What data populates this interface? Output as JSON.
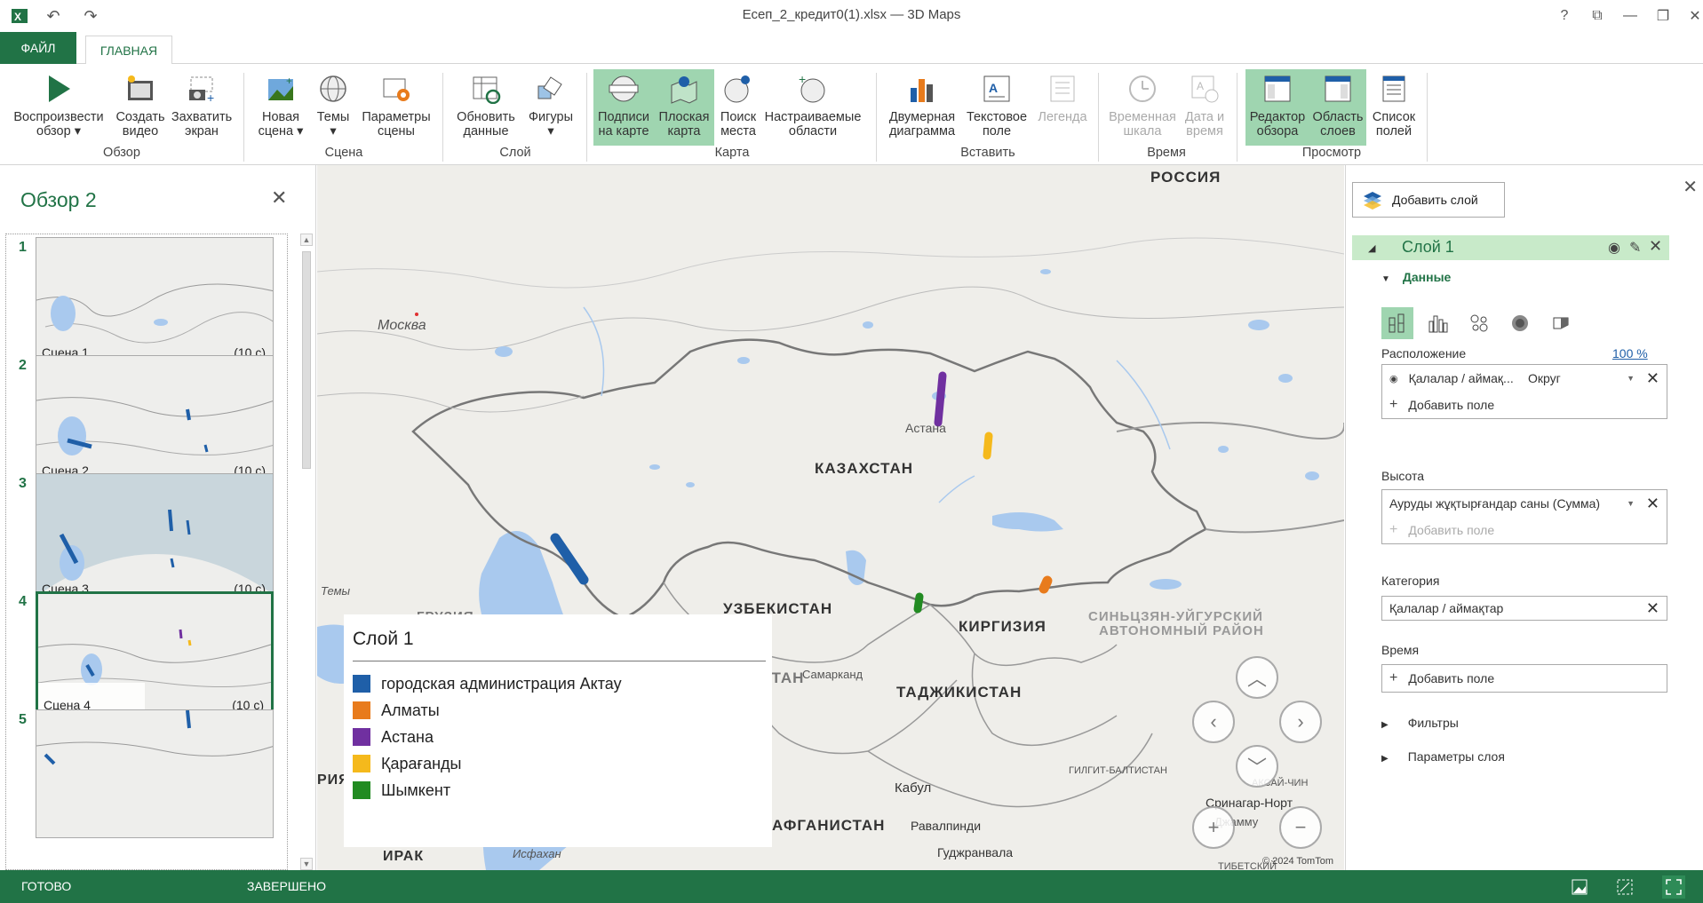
{
  "window": {
    "title": "Есеп_2_кредит0(1).xlsx — 3D Maps"
  },
  "tabs": {
    "file": "ФАЙЛ",
    "home": "ГЛАВНАЯ"
  },
  "ribbon": {
    "tour": {
      "play": [
        "Воспроизвести",
        "обзор ▾"
      ],
      "create_video": [
        "Создать",
        "видео"
      ],
      "capture": [
        "Захватить",
        "экран"
      ],
      "group": "Обзор"
    },
    "scene": {
      "new": [
        "Новая",
        "сцена ▾"
      ],
      "themes": [
        "Темы",
        "▾"
      ],
      "options": [
        "Параметры",
        "сцены"
      ],
      "group": "Сцена"
    },
    "layer": {
      "refresh": [
        "Обновить",
        "данные"
      ],
      "shapes": [
        "Фигуры",
        "▾"
      ],
      "group": "Слой"
    },
    "map": {
      "labels": [
        "Подписи",
        "на карте"
      ],
      "flat": [
        "Плоская",
        "карта"
      ],
      "find": [
        "Поиск",
        "места"
      ],
      "regions": [
        "Настраиваемые",
        "области"
      ],
      "group": "Карта"
    },
    "insert": {
      "chart2d": [
        "Двумерная",
        "диаграмма"
      ],
      "textbox": [
        "Текстовое",
        "поле"
      ],
      "legend": [
        "Легенда",
        ""
      ],
      "group": "Вставить"
    },
    "time": {
      "timeline": [
        "Временная",
        "шкала"
      ],
      "datetime": [
        "Дата и",
        "время"
      ],
      "group": "Время"
    },
    "view": {
      "tour_editor": [
        "Редактор",
        "обзора"
      ],
      "layer_pane": [
        "Область",
        "слоев"
      ],
      "field_list": [
        "Список",
        "полей"
      ],
      "group": "Просмотр"
    }
  },
  "tour_panel": {
    "title": "Обзор 2",
    "scenes": [
      {
        "num": "1",
        "name": "Сцена 1",
        "duration": "(10 с)"
      },
      {
        "num": "2",
        "name": "Сцена 2",
        "duration": "(10 с)"
      },
      {
        "num": "3",
        "name": "Сцена 3",
        "duration": "(10 с)"
      },
      {
        "num": "4",
        "name": "Сцена 4",
        "duration": "(10 с)"
      },
      {
        "num": "5",
        "name": "",
        "duration": ""
      }
    ]
  },
  "map": {
    "labels": {
      "russia": "РОССИЯ",
      "moscow": "Москва",
      "kazakhstan": "КАЗАХСТАН",
      "astana": "Астана",
      "uzbekistan": "УЗБЕКИСТАН",
      "kyrgyzstan": "КИРГИЗИЯ",
      "tajikistan": "ТАДЖИКИСТАН",
      "turkmenistan": "ТУРКМЕНИСТАН",
      "afghanistan": "АФГАНИСТАН",
      "xinjiang1": "СИНЬЦЗЯН-УЙГУРСКИЙ",
      "xinjiang2": "АВТОНОМНЫЙ РАЙОН",
      "samarkand": "Самарканд",
      "kabul": "Кабул",
      "iraq": "ИРАК",
      "georgia": "ГРУЗИЯ",
      "syria": "РИЯ",
      "srinagar": "Сринагар-Норт",
      "gilgit": "ГИЛГИТ-БАЛТИСТАН",
      "tibet": "ТИБЕТСКИЙ АВТОНОМНЫЙ РАЙОН",
      "isfahan": "Исфахан",
      "rawalpindi": "Равалпинди",
      "gujranwala": "Гуджранвала",
      "aksai": "АКСАЙ-ЧИН",
      "jammu": "Джамму",
      "temy": "Темы"
    },
    "copyright": "© 2024 TomTom",
    "legend": {
      "title": "Слой 1",
      "items": [
        {
          "label": " городская администрация Актау",
          "color": "#1f5fa8"
        },
        {
          "label": "Алматы",
          "color": "#e87b1c"
        },
        {
          "label": "Астана",
          "color": "#7030a0"
        },
        {
          "label": "Қарағанды",
          "color": "#f5b91c"
        },
        {
          "label": "Шымкент",
          "color": "#228b22"
        }
      ]
    }
  },
  "layer_pane": {
    "add_layer": "Добавить слой",
    "layer_name": "Слой 1",
    "data_section": "Данные",
    "location_label": "Расположение",
    "location_pct": "100 %",
    "location_field": "Қалалар / аймақ...",
    "location_type": "Округ",
    "add_field": "Добавить поле",
    "height_label": "Высота",
    "height_field": "Ауруды жұқтырғандар саны (Сумма)",
    "category_label": "Категория",
    "category_field": "Қалалар / аймақтар",
    "time_label": "Время",
    "filters": "Фильтры",
    "layer_options": "Параметры слоя"
  },
  "status": {
    "ready": "ГОТОВО",
    "done": "ЗАВЕРШЕНО"
  },
  "colors": {
    "accent": "#217346",
    "active_bg": "#9fd5b0",
    "layer_bar": "#c8eac9"
  }
}
